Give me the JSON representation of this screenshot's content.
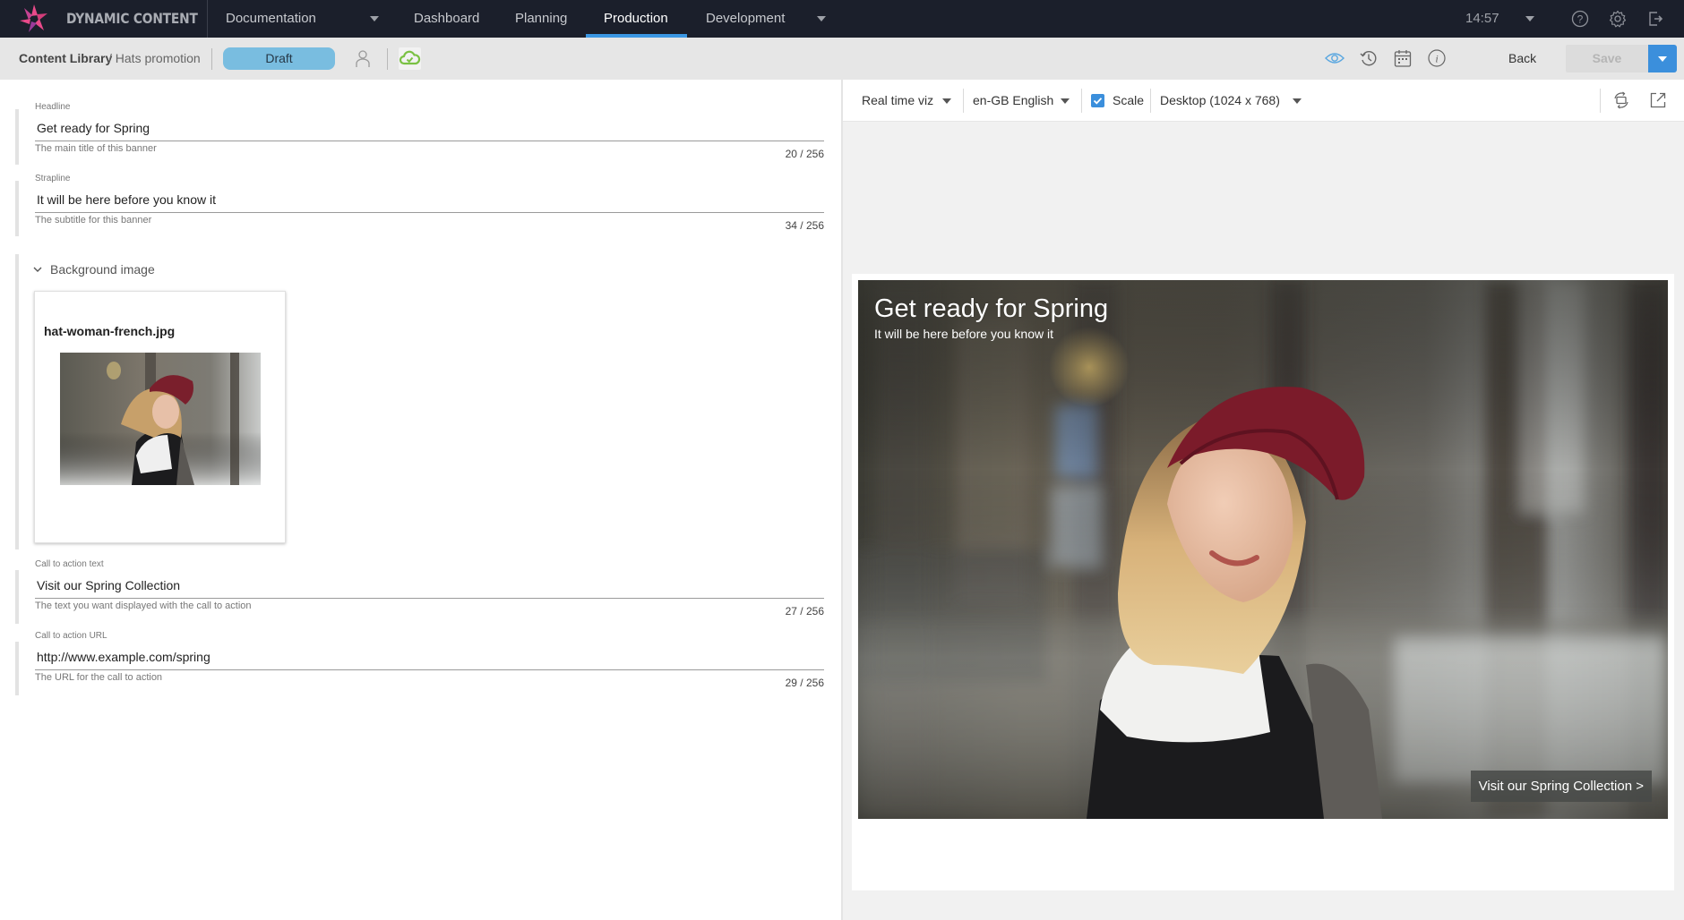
{
  "app": {
    "name": "DYNAMIC CONTENT",
    "brand_colors": {
      "nav_bg": "#1b1f2b",
      "accent": "#3b97e3",
      "draft": "#79bde0",
      "sync_ok": "#7ac143"
    }
  },
  "topnav": {
    "hub_selector": "Documentation",
    "tabs": [
      {
        "label": "Dashboard",
        "active": false
      },
      {
        "label": "Planning",
        "active": false
      },
      {
        "label": "Production",
        "active": true
      },
      {
        "label": "Development",
        "active": false
      }
    ],
    "time": "14:57",
    "icons": [
      "help-icon",
      "gear-icon",
      "logout-icon"
    ]
  },
  "subbar": {
    "breadcrumb_root": "Content Library",
    "breadcrumb_leaf": "/ Hats promotion",
    "status": "Draft",
    "icons": [
      "assignee-icon",
      "cloud-sync-icon",
      "eye-icon",
      "history-icon",
      "calendar-icon",
      "info-icon"
    ],
    "back_label": "Back",
    "save_label": "Save"
  },
  "form": {
    "fields": [
      {
        "label": "Headline",
        "value": "Get ready for Spring",
        "help": "The main title of this banner",
        "count": "20 / 256"
      },
      {
        "label": "Strapline",
        "value": "It will be here before you know it",
        "help": "The subtitle for this banner",
        "count": "34 / 256"
      },
      {
        "label": "Call to action text",
        "value": "Visit our Spring Collection",
        "help": "The text you want displayed with the call to action",
        "count": "27 / 256"
      },
      {
        "label": "Call to action URL",
        "value": "http://www.example.com/spring",
        "help": "The URL for the call to action",
        "count": "29 / 256"
      }
    ],
    "background_image": {
      "section_title": "Background image",
      "file_name": "hat-woman-french.jpg"
    }
  },
  "preview": {
    "mode": "Real time viz",
    "locale": "en-GB English",
    "scale_label": "Scale",
    "scale_checked": true,
    "device": "Desktop (1024 x 768)",
    "icons": [
      "rotate-icon",
      "open-external-icon"
    ],
    "banner": {
      "title": "Get ready for Spring",
      "subtitle": "It will be here before you know it",
      "cta": "Visit our Spring Collection >"
    }
  }
}
